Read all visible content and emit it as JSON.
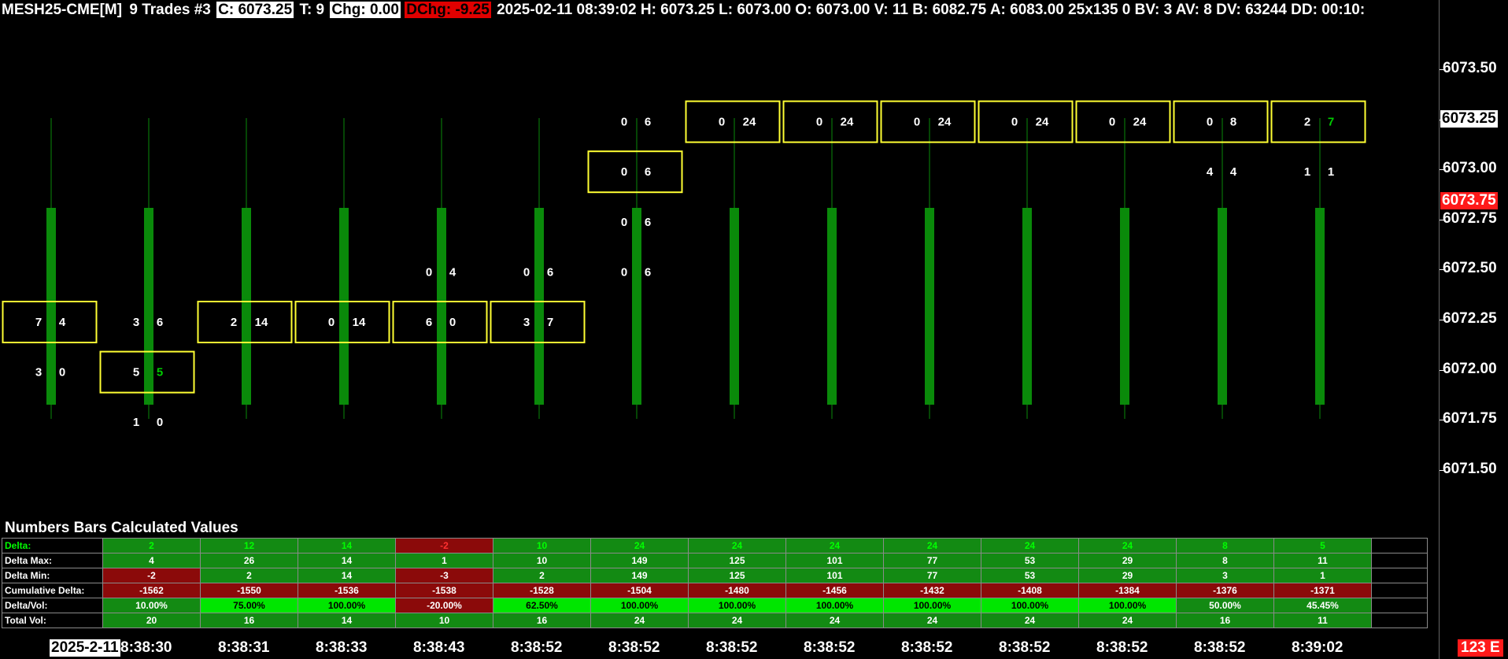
{
  "header": {
    "symbol": "MESH25-CME[M]",
    "trades": "9 Trades #3",
    "close": "C: 6073.25",
    "t": "T: 9",
    "chg": "Chg: 0.00",
    "dchg": "DChg: -9.25",
    "rest": "2025-02-11 08:39:02 H: 6073.25 L: 6073.00 O: 6073.00 V: 11 B: 6082.75 A: 6083.00 25x135 0 BV: 3 AV: 8 DV: 63244 DD: 00:10:"
  },
  "price_axis": {
    "labels": [
      "6073.50",
      "6073.25",
      "6073.00",
      "6072.75",
      "6072.50",
      "6072.25",
      "6072.00",
      "6071.75",
      "6071.50"
    ],
    "current_price": "6073.25",
    "last_trade_price": "6073.75"
  },
  "bars": [
    {
      "time": "2025-2-11",
      "levels": [
        {
          "price": 6072.5,
          "bid": "",
          "ask": ""
        },
        {
          "price": 6072.25,
          "bid": "7",
          "ask": "4",
          "boxed": true
        },
        {
          "price": 6072.0,
          "bid": "3",
          "ask": "0"
        }
      ]
    },
    {
      "time": "8:38:30",
      "levels": [
        {
          "price": 6072.25,
          "bid": "3",
          "ask": "6"
        },
        {
          "price": 6072.0,
          "bid": "5",
          "ask": "5",
          "boxed": true,
          "ask_green": true
        },
        {
          "price": 6071.75,
          "bid": "1",
          "ask": "0"
        }
      ]
    },
    {
      "time": "8:38:31",
      "levels": [
        {
          "price": 6072.25,
          "bid": "2",
          "ask": "14",
          "boxed": true
        }
      ]
    },
    {
      "time": "8:38:33",
      "levels": [
        {
          "price": 6072.25,
          "bid": "0",
          "ask": "14",
          "boxed": true
        }
      ]
    },
    {
      "time": "8:38:43",
      "levels": [
        {
          "price": 6072.5,
          "bid": "0",
          "ask": "4"
        },
        {
          "price": 6072.25,
          "bid": "6",
          "ask": "0",
          "boxed": true
        }
      ]
    },
    {
      "time": "8:38:52",
      "levels": [
        {
          "price": 6072.5,
          "bid": "0",
          "ask": "6"
        },
        {
          "price": 6072.25,
          "bid": "3",
          "ask": "7",
          "boxed": true
        }
      ]
    },
    {
      "time": "8:38:52",
      "levels": [
        {
          "price": 6073.25,
          "bid": "0",
          "ask": "6"
        },
        {
          "price": 6073.0,
          "bid": "0",
          "ask": "6",
          "boxed": true
        },
        {
          "price": 6072.75,
          "bid": "0",
          "ask": "6"
        },
        {
          "price": 6072.5,
          "bid": "0",
          "ask": "6"
        }
      ]
    },
    {
      "time": "8:38:52",
      "levels": [
        {
          "price": 6073.25,
          "bid": "0",
          "ask": "24",
          "boxed": true
        }
      ]
    },
    {
      "time": "8:38:52",
      "levels": [
        {
          "price": 6073.25,
          "bid": "0",
          "ask": "24",
          "boxed": true
        }
      ]
    },
    {
      "time": "8:38:52",
      "levels": [
        {
          "price": 6073.25,
          "bid": "0",
          "ask": "24",
          "boxed": true
        }
      ]
    },
    {
      "time": "8:38:52",
      "levels": [
        {
          "price": 6073.25,
          "bid": "0",
          "ask": "24",
          "boxed": true
        }
      ]
    },
    {
      "time": "8:38:52",
      "levels": [
        {
          "price": 6073.25,
          "bid": "0",
          "ask": "24",
          "boxed": true
        }
      ]
    },
    {
      "time": "8:38:52",
      "levels": [
        {
          "price": 6073.25,
          "bid": "0",
          "ask": "8",
          "boxed": true
        },
        {
          "price": 6073.0,
          "bid": "4",
          "ask": "4"
        }
      ]
    },
    {
      "time": "8:39:02",
      "levels": [
        {
          "price": 6073.25,
          "bid": "2",
          "ask": "7",
          "boxed": true,
          "ask_green": true
        },
        {
          "price": 6073.0,
          "bid": "1",
          "ask": "1"
        }
      ]
    }
  ],
  "table": {
    "title": "Numbers Bars Calculated Values",
    "rows": [
      {
        "label": "Delta:",
        "label_class": "grn-txt",
        "cells": [
          {
            "v": "2",
            "c": "g1 grn-txt"
          },
          {
            "v": "12",
            "c": "g1 grn-txt"
          },
          {
            "v": "14",
            "c": "g1 grn-txt"
          },
          {
            "v": "-2",
            "c": "r1 red-txt"
          },
          {
            "v": "10",
            "c": "g1 grn-txt"
          },
          {
            "v": "24",
            "c": "g1 grn-txt"
          },
          {
            "v": "24",
            "c": "g1 grn-txt"
          },
          {
            "v": "24",
            "c": "g1 grn-txt"
          },
          {
            "v": "24",
            "c": "g1 grn-txt"
          },
          {
            "v": "24",
            "c": "g1 grn-txt"
          },
          {
            "v": "24",
            "c": "g1 grn-txt"
          },
          {
            "v": "8",
            "c": "g1 grn-txt"
          },
          {
            "v": "5",
            "c": "g1 grn-txt"
          }
        ]
      },
      {
        "label": "Delta Max:",
        "cells": [
          {
            "v": "4",
            "c": "g1"
          },
          {
            "v": "26",
            "c": "g1"
          },
          {
            "v": "14",
            "c": "g1"
          },
          {
            "v": "1",
            "c": "g1"
          },
          {
            "v": "10",
            "c": "g1"
          },
          {
            "v": "149",
            "c": "g1"
          },
          {
            "v": "125",
            "c": "g1"
          },
          {
            "v": "101",
            "c": "g1"
          },
          {
            "v": "77",
            "c": "g1"
          },
          {
            "v": "53",
            "c": "g1"
          },
          {
            "v": "29",
            "c": "g1"
          },
          {
            "v": "8",
            "c": "g1"
          },
          {
            "v": "11",
            "c": "g1"
          }
        ]
      },
      {
        "label": "Delta Min:",
        "cells": [
          {
            "v": "-2",
            "c": "r1"
          },
          {
            "v": "2",
            "c": "g1"
          },
          {
            "v": "14",
            "c": "g1"
          },
          {
            "v": "-3",
            "c": "r1"
          },
          {
            "v": "2",
            "c": "g1"
          },
          {
            "v": "149",
            "c": "g1"
          },
          {
            "v": "125",
            "c": "g1"
          },
          {
            "v": "101",
            "c": "g1"
          },
          {
            "v": "77",
            "c": "g1"
          },
          {
            "v": "53",
            "c": "g1"
          },
          {
            "v": "29",
            "c": "g1"
          },
          {
            "v": "3",
            "c": "g1"
          },
          {
            "v": "1",
            "c": "g1"
          }
        ]
      },
      {
        "label": "Cumulative Delta:",
        "cells": [
          {
            "v": "-1562",
            "c": "r1"
          },
          {
            "v": "-1550",
            "c": "r1"
          },
          {
            "v": "-1536",
            "c": "r1"
          },
          {
            "v": "-1538",
            "c": "r1"
          },
          {
            "v": "-1528",
            "c": "r1"
          },
          {
            "v": "-1504",
            "c": "r1"
          },
          {
            "v": "-1480",
            "c": "r1"
          },
          {
            "v": "-1456",
            "c": "r1"
          },
          {
            "v": "-1432",
            "c": "r1"
          },
          {
            "v": "-1408",
            "c": "r1"
          },
          {
            "v": "-1384",
            "c": "r1"
          },
          {
            "v": "-1376",
            "c": "r1"
          },
          {
            "v": "-1371",
            "c": "r1"
          }
        ]
      },
      {
        "label": "Delta/Vol:",
        "cells": [
          {
            "v": "10.00%",
            "c": "g1"
          },
          {
            "v": "75.00%",
            "c": "g2"
          },
          {
            "v": "100.00%",
            "c": "g2"
          },
          {
            "v": "-20.00%",
            "c": "r1"
          },
          {
            "v": "62.50%",
            "c": "g2"
          },
          {
            "v": "100.00%",
            "c": "g2"
          },
          {
            "v": "100.00%",
            "c": "g2"
          },
          {
            "v": "100.00%",
            "c": "g2"
          },
          {
            "v": "100.00%",
            "c": "g2"
          },
          {
            "v": "100.00%",
            "c": "g2"
          },
          {
            "v": "100.00%",
            "c": "g2"
          },
          {
            "v": "50.00%",
            "c": "g1"
          },
          {
            "v": "45.45%",
            "c": "g1"
          }
        ]
      },
      {
        "label": "Total Vol:",
        "cells": [
          {
            "v": "20",
            "c": "g1"
          },
          {
            "v": "16",
            "c": "g1"
          },
          {
            "v": "14",
            "c": "g1"
          },
          {
            "v": "10",
            "c": "g1"
          },
          {
            "v": "16",
            "c": "g1"
          },
          {
            "v": "24",
            "c": "g1"
          },
          {
            "v": "24",
            "c": "g1"
          },
          {
            "v": "24",
            "c": "g1"
          },
          {
            "v": "24",
            "c": "g1"
          },
          {
            "v": "24",
            "c": "g1"
          },
          {
            "v": "24",
            "c": "g1"
          },
          {
            "v": "16",
            "c": "g1"
          },
          {
            "v": "11",
            "c": "g1"
          }
        ]
      }
    ]
  },
  "corner_badge": "123 E",
  "colors": {
    "candle": "#0a8a0a",
    "box": "#ffff33",
    "wick": "#0a8a0a"
  }
}
